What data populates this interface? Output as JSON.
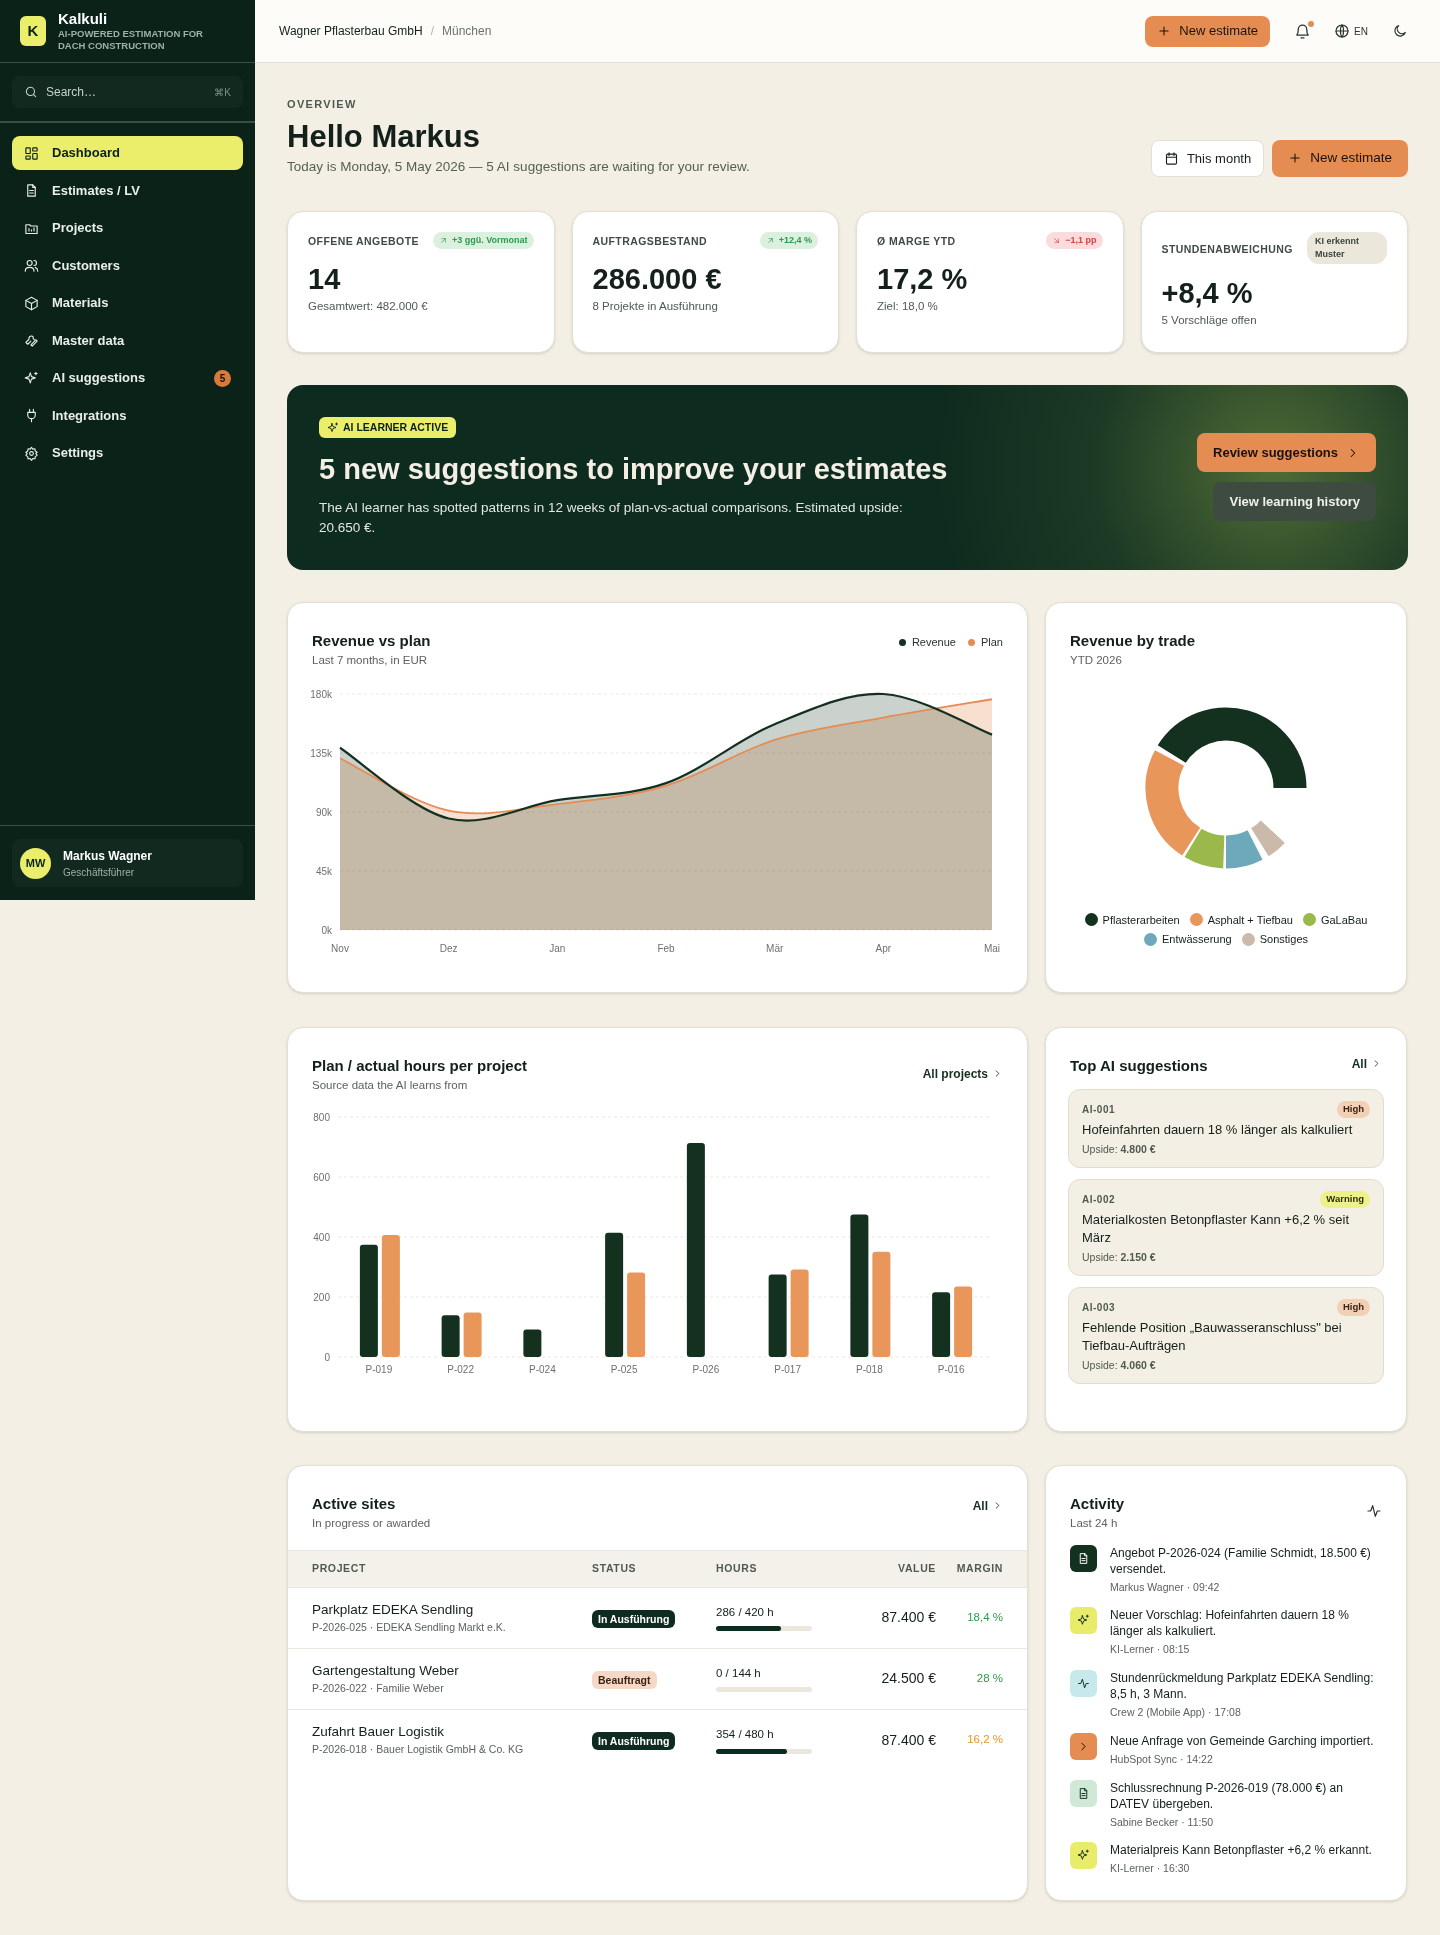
{
  "brand": {
    "logo_letter": "K",
    "name": "Kalkuli",
    "tagline": "AI-POWERED ESTIMATION FOR DACH CONSTRUCTION"
  },
  "search": {
    "placeholder": "Search…",
    "shortcut": "⌘K"
  },
  "nav": [
    {
      "label": "Dashboard",
      "selected": true
    },
    {
      "label": "Estimates / LV",
      "selected": false
    },
    {
      "label": "Projects",
      "selected": false
    },
    {
      "label": "Customers",
      "selected": false
    },
    {
      "label": "Materials",
      "selected": false
    },
    {
      "label": "Master data",
      "selected": false
    },
    {
      "label": "AI suggestions",
      "selected": false,
      "badge": "5"
    },
    {
      "label": "Integrations",
      "selected": false
    },
    {
      "label": "Settings",
      "selected": false
    }
  ],
  "user": {
    "initials": "MW",
    "name": "Markus Wagner",
    "role": "Geschäftsführer"
  },
  "header": {
    "company": "Wagner Pflasterbau GmbH",
    "separator": "/",
    "location": "München",
    "new_button": "New estimate",
    "notifications_unread": true,
    "language": "EN"
  },
  "overview": {
    "eyebrow": "OVERVIEW",
    "title": "Hello Markus",
    "subtitle": "Today is Monday, 5 May 2026 — 5 AI suggestions are waiting for your review.",
    "period_button": "This month",
    "new_button": "New estimate"
  },
  "kpis": [
    {
      "label": "OFFENE ANGEBOTE",
      "badge": {
        "text": "+3 ggü. Vormonat",
        "kind": "up"
      },
      "value": "14",
      "note": "Gesamtwert: 482.000 €"
    },
    {
      "label": "AUFTRAGSBESTAND",
      "badge": {
        "text": "+12,4 %",
        "kind": "up"
      },
      "value": "286.000 €",
      "note": "8 Projekte in Ausführung"
    },
    {
      "label": "Ø MARGE YTD",
      "badge": {
        "text": "−1,1 pp",
        "kind": "down"
      },
      "value": "17,2 %",
      "note": "Ziel: 18,0 %"
    },
    {
      "label": "STUNDENABWEICHUNG",
      "badge": {
        "text": "KI erkennt Muster",
        "kind": "neutral"
      },
      "value": "+8,4 %",
      "note": "5 Vorschläge offen"
    }
  ],
  "banner": {
    "tag": "AI LEARNER ACTIVE",
    "title": "5 new suggestions to improve your estimates",
    "text": "The AI learner has spotted patterns in 12 weeks of plan-vs-actual comparisons. Estimated upside: 20.650 €.",
    "primary_button": "Review suggestions",
    "secondary_button": "View learning history"
  },
  "revenue": {
    "title": "Revenue vs plan",
    "subtitle": "Last 7 months, in EUR",
    "chart_data": {
      "type": "area",
      "grid": true,
      "categories": [
        "Nov",
        "Dez",
        "Jan",
        "Feb",
        "Mär",
        "Apr",
        "Mai"
      ],
      "ylim": [
        0,
        180
      ],
      "yticks": [
        {
          "value": 0,
          "label": "0k"
        },
        {
          "value": 45,
          "label": "45k"
        },
        {
          "value": 90,
          "label": "90k"
        },
        {
          "value": 135,
          "label": "135k"
        },
        {
          "value": 180,
          "label": "180k"
        }
      ],
      "series": [
        {
          "name": "Revenue",
          "color": "#14301f",
          "values": [
            139,
            85,
            99,
            112,
            157,
            180,
            149
          ]
        },
        {
          "name": "Plan",
          "color": "#e58c53",
          "values": [
            131,
            91,
            96,
            110,
            145,
            162,
            176
          ]
        }
      ]
    }
  },
  "trades": {
    "title": "Revenue by trade",
    "subtitle": "YTD 2026",
    "segments": [
      {
        "label": "Pflasterarbeiten",
        "color": "#14301f"
      },
      {
        "label": "Asphalt + Tiefbau",
        "color": "#e8965a"
      },
      {
        "label": "GaLaBau",
        "color": "#9bb84a"
      },
      {
        "label": "Entwässerung",
        "color": "#6ea9bb"
      },
      {
        "label": "Sonstiges",
        "color": "#cbb9aa"
      }
    ]
  },
  "hours": {
    "title": "Plan / actual hours per project",
    "subtitle": "Source data the AI learns from",
    "link": "All projects",
    "chart_data": {
      "type": "bar",
      "grid": true,
      "categories": [
        "P-019",
        "P-022",
        "P-024",
        "P-025",
        "P-026",
        "P-017",
        "P-018",
        "P-016"
      ],
      "ylim": [
        0,
        800
      ],
      "yticks": [
        {
          "value": 0,
          "label": "0"
        },
        {
          "value": 200,
          "label": "200"
        },
        {
          "value": 400,
          "label": "400"
        },
        {
          "value": 600,
          "label": "600"
        },
        {
          "value": 800,
          "label": "800"
        }
      ],
      "series": [
        {
          "color": "#14301f",
          "values": [
            374,
            139,
            92,
            414,
            713,
            275,
            475,
            216
          ]
        },
        {
          "color": "#e8965a",
          "values": [
            407,
            148,
            null,
            282,
            null,
            292,
            351,
            235
          ]
        }
      ]
    }
  },
  "suggestions": {
    "title": "Top AI suggestions",
    "link": "All",
    "items": [
      {
        "id": "AI-001",
        "priority": "High",
        "kind": "high",
        "text": "Hofeinfahrten dauern 18 % länger als kalkuliert",
        "upside": "Upside: **4.800 €**"
      },
      {
        "id": "AI-002",
        "priority": "Warning",
        "kind": "warning",
        "text": "Materialkosten Betonpflaster Kann +6,2 % seit März",
        "upside": "Upside: **2.150 €**"
      },
      {
        "id": "AI-003",
        "priority": "High",
        "kind": "high",
        "text": "Fehlende Position „Bauwasseranschluss\" bei Tiefbau-Aufträgen",
        "upside": "Upside: **4.060 €**"
      }
    ]
  },
  "sites": {
    "title": "Active sites",
    "subtitle": "In progress or awarded",
    "link": "All",
    "columns": [
      "PROJECT",
      "STATUS",
      "HOURS",
      "VALUE",
      "MARGIN"
    ],
    "rows": [
      {
        "name": "Parkplatz EDEKA Sendling",
        "meta": "P-2026-025 · EDEKA Sendling Markt e.K.",
        "status": {
          "text": "In Ausführung",
          "kind": "running"
        },
        "hours": "286 / 420 h",
        "level": 0.68,
        "value": "87.400 €",
        "margin": {
          "text": "18,4 %",
          "kind": "good"
        }
      },
      {
        "name": "Gartengestaltung Weber",
        "meta": "P-2026-022 · Familie Weber",
        "status": {
          "text": "Beauftragt",
          "kind": "awarded"
        },
        "hours": "0 / 144 h",
        "level": 0,
        "value": "24.500 €",
        "margin": {
          "text": "28 %",
          "kind": "good"
        }
      },
      {
        "name": "Zufahrt Bauer Logistik",
        "meta": "P-2026-018 · Bauer Logistik GmbH & Co. KG",
        "status": {
          "text": "In Ausführung",
          "kind": "running"
        },
        "hours": "354 / 480 h",
        "level": 0.74,
        "value": "87.400 €",
        "margin": {
          "text": "16,2 %",
          "kind": "warn"
        }
      }
    ]
  },
  "activity": {
    "title": "Activity",
    "subtitle": "Last 24 h",
    "items": [
      {
        "kind": "sent",
        "text": "Angebot P-2026-024 (Familie Schmidt, 18.500 €) versendet.",
        "meta": "Markus Wagner · 09:42"
      },
      {
        "kind": "suggestion",
        "text": "Neuer Vorschlag: Hofeinfahrten dauern 18 % länger als kalkuliert.",
        "meta": "KI-Lerner · 08:15"
      },
      {
        "kind": "hours",
        "text": "Stundenrückmeldung Parkplatz EDEKA Sendling: 8,5 h, 3 Mann.",
        "meta": "Crew 2 (Mobile App) · 17:08"
      },
      {
        "kind": "import",
        "text": "Neue Anfrage von Gemeinde Garching importiert.",
        "meta": "HubSpot Sync · 14:22"
      },
      {
        "kind": "invoice",
        "text": "Schlussrechnung P-2026-019 (78.000 €) an DATEV übergeben.",
        "meta": "Sabine Becker · 11:50"
      },
      {
        "kind": "suggestion",
        "text": "Materialpreis Kann Betonpflaster +6,2 % erkannt.",
        "meta": "KI-Lerner · 16:30"
      }
    ]
  }
}
